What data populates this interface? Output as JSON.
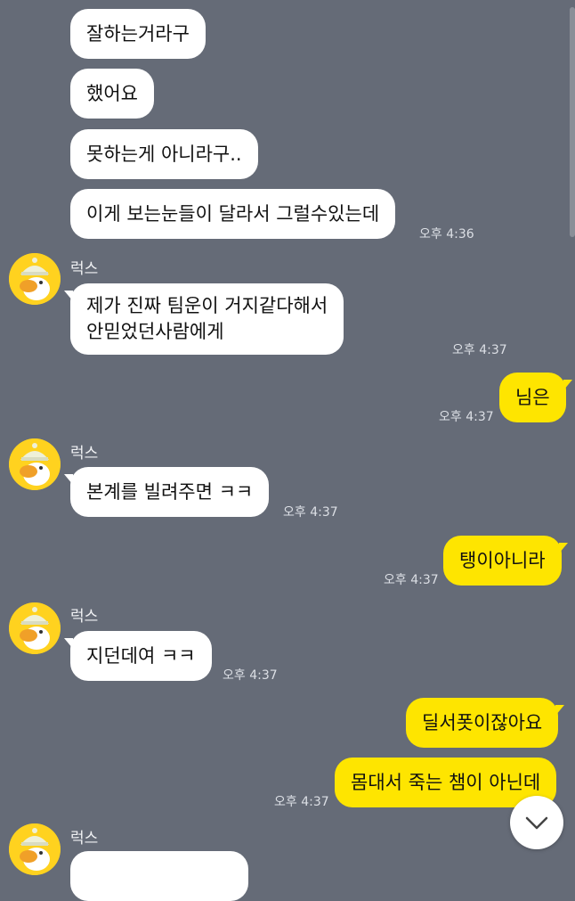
{
  "messages": [
    {
      "text": "잘하는거라구"
    },
    {
      "text": "했어요"
    },
    {
      "text": "못하는게 아니라구.."
    },
    {
      "text": "이게 보는눈들이 달라서 그럴수있는데",
      "time": "오후 4:36"
    },
    {
      "sender": "럭스",
      "lines": [
        "제가 진짜 팀운이 거지같다해서",
        "안믿었던사람에게"
      ],
      "time": "오후 4:37"
    },
    {
      "text": "님은",
      "time": "오후 4:37"
    },
    {
      "sender": "럭스",
      "text": "본계를 빌려주면 ㅋㅋ",
      "time": "오후 4:37"
    },
    {
      "text": "탱이아니라",
      "time": "오후 4:37"
    },
    {
      "sender": "럭스",
      "text": "지던데여 ㅋㅋ",
      "time": "오후 4:37"
    },
    {
      "text": "딜서폿이잖아요"
    },
    {
      "text": "몸대서 죽는 챔이 아닌데",
      "time": "오후 4:37"
    },
    {
      "sender": "럭스"
    }
  ],
  "icons": {
    "avatar": "ryan-character-avatar-icon",
    "scroll_down": "chevron-down-icon"
  },
  "colors": {
    "background": "#656b77",
    "incoming_bubble": "#ffffff",
    "outgoing_bubble": "#fee500"
  }
}
